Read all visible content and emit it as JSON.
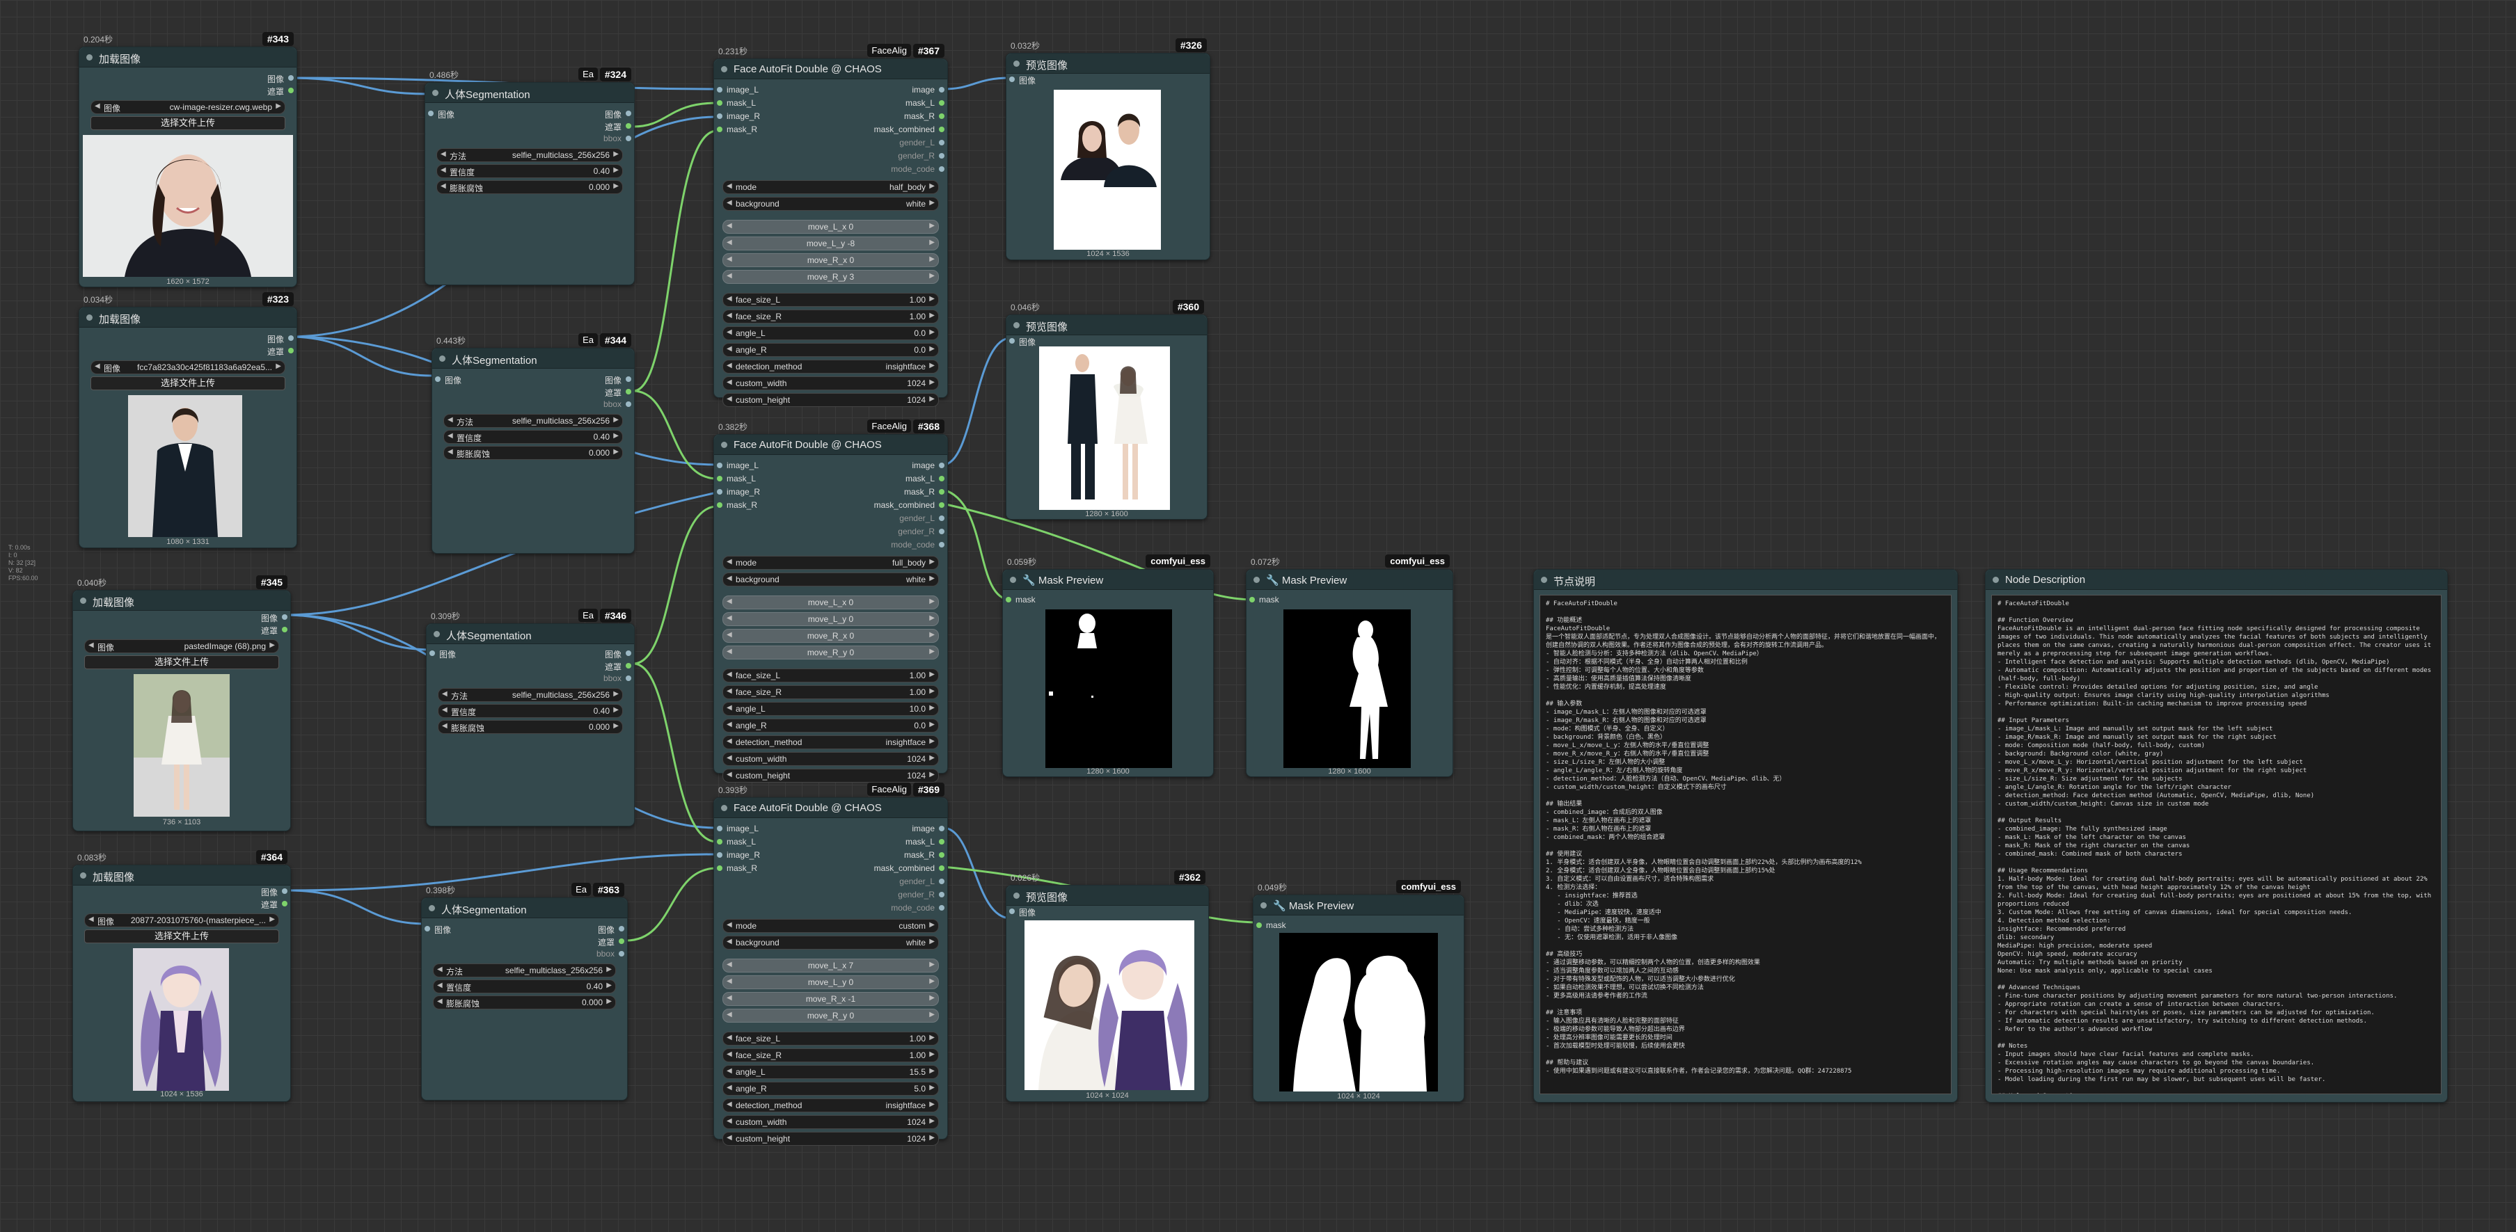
{
  "sideinfo": "T: 0.00s\nI: 0\nN: 32 [32]\nV: 82\nFPS:60.00",
  "load": [
    {
      "id": "#343",
      "time": "0.204秒",
      "title": "加载图像",
      "out1": "图像",
      "out2": "遮罩",
      "label": "图像",
      "file": "cw-image-resizer.cwg.webp",
      "upload": "选择文件上传",
      "size": "1620 × 1572"
    },
    {
      "id": "#323",
      "time": "0.034秒",
      "title": "加载图像",
      "out1": "图像",
      "out2": "遮罩",
      "label": "图像",
      "file": "fcc7a823a30c425f81183a6a92ea5...",
      "upload": "选择文件上传",
      "size": "1080 × 1331"
    },
    {
      "id": "#345",
      "time": "0.040秒",
      "title": "加载图像",
      "out1": "图像",
      "out2": "遮罩",
      "label": "图像",
      "file": "pastedImage (68).png",
      "upload": "选择文件上传",
      "size": "736 × 1103"
    },
    {
      "id": "#364",
      "time": "0.083秒",
      "title": "加载图像",
      "out1": "图像",
      "out2": "遮罩",
      "label": "图像",
      "file": "20877-2031075760-(masterpiece_...",
      "upload": "选择文件上传",
      "size": "1024 × 1536"
    }
  ],
  "seg": [
    {
      "id": "#324",
      "tag": "Ea",
      "time": "0.486秒",
      "title": "人体Segmentation",
      "input": "图像",
      "out1": "图像",
      "out2": "遮罩",
      "out3": "bbox",
      "method_l": "方法",
      "method_v": "selfie_multiclass_256x256",
      "thr_l": "置信度",
      "thr_v": "0.40",
      "exp_l": "膨胀腐蚀",
      "exp_v": "0.000"
    },
    {
      "id": "#344",
      "tag": "Ea",
      "time": "0.443秒",
      "title": "人体Segmentation",
      "input": "图像",
      "out1": "图像",
      "out2": "遮罩",
      "out3": "bbox",
      "method_l": "方法",
      "method_v": "selfie_multiclass_256x256",
      "thr_l": "置信度",
      "thr_v": "0.40",
      "exp_l": "膨胀腐蚀",
      "exp_v": "0.000"
    },
    {
      "id": "#346",
      "tag": "Ea",
      "time": "0.309秒",
      "title": "人体Segmentation",
      "input": "图像",
      "out1": "图像",
      "out2": "遮罩",
      "out3": "bbox",
      "method_l": "方法",
      "method_v": "selfie_multiclass_256x256",
      "thr_l": "置信度",
      "thr_v": "0.40",
      "exp_l": "膨胀腐蚀",
      "exp_v": "0.000"
    },
    {
      "id": "#363",
      "tag": "Ea",
      "time": "0.398秒",
      "title": "人体Segmentation",
      "input": "图像",
      "out1": "图像",
      "out2": "遮罩",
      "out3": "bbox",
      "method_l": "方法",
      "method_v": "selfie_multiclass_256x256",
      "thr_l": "置信度",
      "thr_v": "0.40",
      "exp_l": "膨胀腐蚀",
      "exp_v": "0.000"
    }
  ],
  "fa": [
    {
      "id": "#367",
      "tag": "FaceAlig",
      "time": "0.231秒",
      "title": "Face AutoFit Double @ CHAOS",
      "inputs": [
        "image_L",
        "mask_L",
        "image_R",
        "mask_R"
      ],
      "outputs": [
        "image",
        "mask_L",
        "mask_R",
        "mask_combined",
        "gender_L",
        "gender_R",
        "mode_code"
      ],
      "widgets": [
        [
          "mode",
          "half_body"
        ],
        [
          "background",
          "white"
        ],
        [
          "move_L_x",
          "0"
        ],
        [
          "move_L_y",
          "-8"
        ],
        [
          "move_R_x",
          "0"
        ],
        [
          "move_R_y",
          "3"
        ],
        [
          "face_size_L",
          "1.00"
        ],
        [
          "face_size_R",
          "1.00"
        ],
        [
          "angle_L",
          "0.0"
        ],
        [
          "angle_R",
          "0.0"
        ],
        [
          "detection_method",
          "insightface"
        ],
        [
          "custom_width",
          "1024"
        ],
        [
          "custom_height",
          "1024"
        ]
      ]
    },
    {
      "id": "#368",
      "tag": "FaceAlig",
      "time": "0.382秒",
      "title": "Face AutoFit Double @ CHAOS",
      "inputs": [
        "image_L",
        "mask_L",
        "image_R",
        "mask_R"
      ],
      "outputs": [
        "image",
        "mask_L",
        "mask_R",
        "mask_combined",
        "gender_L",
        "gender_R",
        "mode_code"
      ],
      "widgets": [
        [
          "mode",
          "full_body"
        ],
        [
          "background",
          "white"
        ],
        [
          "move_L_x",
          "0"
        ],
        [
          "move_L_y",
          "0"
        ],
        [
          "move_R_x",
          "0"
        ],
        [
          "move_R_y",
          "0"
        ],
        [
          "face_size_L",
          "1.00"
        ],
        [
          "face_size_R",
          "1.00"
        ],
        [
          "angle_L",
          "10.0"
        ],
        [
          "angle_R",
          "0.0"
        ],
        [
          "detection_method",
          "insightface"
        ],
        [
          "custom_width",
          "1024"
        ],
        [
          "custom_height",
          "1024"
        ]
      ]
    },
    {
      "id": "#369",
      "tag": "FaceAlig",
      "time": "0.393秒",
      "title": "Face AutoFit Double @ CHAOS",
      "inputs": [
        "image_L",
        "mask_L",
        "image_R",
        "mask_R"
      ],
      "outputs": [
        "image",
        "mask_L",
        "mask_R",
        "mask_combined",
        "gender_L",
        "gender_R",
        "mode_code"
      ],
      "widgets": [
        [
          "mode",
          "custom"
        ],
        [
          "background",
          "white"
        ],
        [
          "move_L_x",
          "7"
        ],
        [
          "move_L_y",
          "0"
        ],
        [
          "move_R_x",
          "-1"
        ],
        [
          "move_R_y",
          "0"
        ],
        [
          "face_size_L",
          "1.00"
        ],
        [
          "face_size_R",
          "1.00"
        ],
        [
          "angle_L",
          "15.5"
        ],
        [
          "angle_R",
          "5.0"
        ],
        [
          "detection_method",
          "insightface"
        ],
        [
          "custom_width",
          "1024"
        ],
        [
          "custom_height",
          "1024"
        ]
      ]
    }
  ],
  "preview": [
    {
      "id": "#326",
      "time": "0.032秒",
      "title": "预览图像",
      "input": "图像",
      "size": "1024 × 1536"
    },
    {
      "id": "#360",
      "time": "0.046秒",
      "title": "预览图像",
      "input": "图像",
      "size": "1280 × 1600"
    },
    {
      "id": "#362",
      "time": "0.026秒",
      "title": "预览图像",
      "input": "图像",
      "size": "1024 × 1024"
    }
  ],
  "mask": [
    {
      "id": "#370",
      "tag": "comfyui_ess",
      "time": "0.059秒",
      "title": "Mask Preview",
      "input": "mask",
      "size": "1280 × 1600"
    },
    {
      "id": "#352",
      "tag": "comfyui_ess",
      "time": "0.072秒",
      "title": "Mask Preview",
      "input": "mask",
      "size": "1280 × 1600"
    },
    {
      "id": "#365",
      "tag": "comfyui_ess",
      "time": "0.049秒",
      "title": "Mask Preview",
      "input": "mask",
      "size": "1024 × 1024"
    }
  ],
  "note_cn": {
    "title": "节点说明",
    "text": "# FaceAutoFitDouble\n\n## 功能概述\nFaceAutoFitDouble\n是一个智能双人面部适配节点，专为处理双人合成图像设计。该节点能够自动分析两个人物的面部特征，并将它们和谐地放置在同一幅画面中，创建自然协调的双人构图效果。作者还将其作为图像合成的预处理，会有对齐的旋转工作流调用产品。\n- 智能人脸检测与分析：支持多种检测方法（dlib、OpenCV、MediaPipe）\n- 自动对齐：根据不同模式（半身、全身）自动计算两人相对位置和比例\n- 弹性控制：可调整每个人物的位置、大小和角度等参数\n- 高质量输出：使用高质量插值算法保持图像清晰度\n- 性能优化：内置缓存机制，提高处理速度\n\n## 输入参数\n- image_L/mask_L：左侧人物的图像和对应的可选遮罩\n- image_R/mask_R：右侧人物的图像和对应的可选遮罩\n- mode：构图模式（半身、全身、自定义）\n- background：背景颜色（白色、黑色）\n- move_L_x/move_L_y：左侧人物的水平/垂直位置调整\n- move_R_x/move_R_y：右侧人物的水平/垂直位置调整\n- size_L/size_R：左侧人物的大小调整\n- angle_L/angle_R：左/右侧人物的旋转角度\n- detection_method：人脸检测方法（自动、OpenCV、MediaPipe、dlib、无）\n- custom_width/custom_height：自定义模式下的画布尺寸\n\n## 输出结果\n- combined_image：合成后的双人图像\n- mask_L：左侧人物在画布上的遮罩\n- mask_R：右侧人物在画布上的遮罩\n- combined_mask：两个人物的组合遮罩\n\n## 使用建议\n1. 半身模式：适合创建双人半身像，人物眼睛位置会自动调整到画面上部约22%处，头部比例约为画布高度的12%\n2. 全身模式：适合创建双人全身像，人物眼睛位置会自动调整到画面上部约15%处\n3. 自定义模式：可以自由设置画布尺寸，适合特殊构图需求\n4. 检测方法选择：\n   - insightface：推荐首选\n   - dlib：次选\n   - MediaPipe：速度较快，速度适中\n   - OpenCV：速度最快，精度一般\n   - 自动：尝试多种检测方法\n   - 无：仅使用遮罩检测，适用于非人像图像\n\n## 高级技巧\n- 通过调整移动参数，可以精细控制两个人物的位置，创造更多样的构图效果\n- 适当调整角度参数可以增加两人之间的互动感\n- 对于带有特殊发型或配饰的人物，可以适当调整大小参数进行优化\n- 如果自动检测效果不理想，可以尝试切换不同检测方法\n- 更多高级用法请参考作者的工作流\n\n## 注意事项\n- 输入图像应具有清晰的人脸和完整的面部特征\n- 极端的移动参数可能导致人物部分超出画布边界\n- 处理高分辨率图像可能需要更长的处理时间\n- 首次加载模型时处理可能较慢，后续使用会更快\n\n## 帮助与建议\n- 使用中如果遇到问题或有建议可以直接联系作者，作者会记录您的需求，为您解决问题。QQ群：247228875"
  },
  "note_en": {
    "title": "Node Description",
    "text": "# FaceAutoFitDouble\n\n## Function Overview\nFaceAutoFitDouble is an intelligent dual-person face fitting node specifically designed for processing composite images of two individuals. This node automatically analyzes the facial features of both subjects and intelligently places them on the same canvas, creating a naturally harmonious dual-person composition effect. The creator uses it merely as a preprocessing step for subsequent image generation workflows.\n- Intelligent face detection and analysis: Supports multiple detection methods (dlib, OpenCV, MediaPipe)\n- Automatic composition: Automatically adjusts the position and proportion of the subjects based on different modes (half-body, full-body)\n- Flexible control: Provides detailed options for adjusting position, size, and angle\n- High-quality output: Ensures image clarity using high-quality interpolation algorithms\n- Performance optimization: Built-in caching mechanism to improve processing speed\n\n## Input Parameters\n- image_L/mask_L: Image and manually set output mask for the left subject\n- image_R/mask_R: Image and manually set output mask for the right subject\n- mode: Composition mode (half-body, full-body, custom)\n- background: Background color (white, gray)\n- move_L_x/move_L_y: Horizontal/vertical position adjustment for the left subject\n- move_R_x/move_R_y: Horizontal/vertical position adjustment for the right subject\n- size_L/size_R: Size adjustment for the subjects\n- angle_L/angle_R: Rotation angle for the left/right character\n- detection_method: Face detection method (Automatic, OpenCV, MediaPipe, dlib, None)\n- custom_width/custom_height: Canvas size in custom mode\n\n## Output Results\n- combined_image: The fully synthesized image\n- mask_L: Mask of the left character on the canvas\n- mask_R: Mask of the right character on the canvas\n- combined_mask: Combined mask of both characters\n\n## Usage Recommendations\n1. Half-body Mode: Ideal for creating dual half-body portraits; eyes will be automatically positioned at about 22% from the top of the canvas, with head height approximately 12% of the canvas height\n2. Full-body Mode: Ideal for creating dual full-body portraits; eyes are positioned at about 15% from the top, with proportions reduced\n3. Custom Mode: Allows free setting of canvas dimensions, ideal for special composition needs.\n4. Detection method selection:\ninsightface: Recommended preferred\ndlib: secondary\nMediaPipe: high precision, moderate speed\nOpenCV: high speed, moderate accuracy\nAutomatic: Try multiple methods based on priority\nNone: Use mask analysis only, applicable to special cases\n\n## Advanced Techniques\n- Fine-tune character positions by adjusting movement parameters for more natural two-person interactions.\n- Appropriate rotation can create a sense of interaction between characters.\n- For characters with special hairstyles or poses, size parameters can be adjusted for optimization.\n- If automatic detection results are unsatisfactory, try switching to different detection methods.\n- Refer to the author's advanced workflow\n\n## Notes\n- Input images should have clear facial features and complete masks.\n- Excessive rotation angles may cause characters to go beyond the canvas boundaries.\n- Processing high-resolution images may require additional processing time.\n- Model loading during the first run may be slower, but subsequent uses will be faster.\n\n## Help and Suggestions\n- If you encounter issues or have suggestions while using, contact the author via the QQ group: 247228875. The author will document your needs and assist in resolving problems."
  }
}
